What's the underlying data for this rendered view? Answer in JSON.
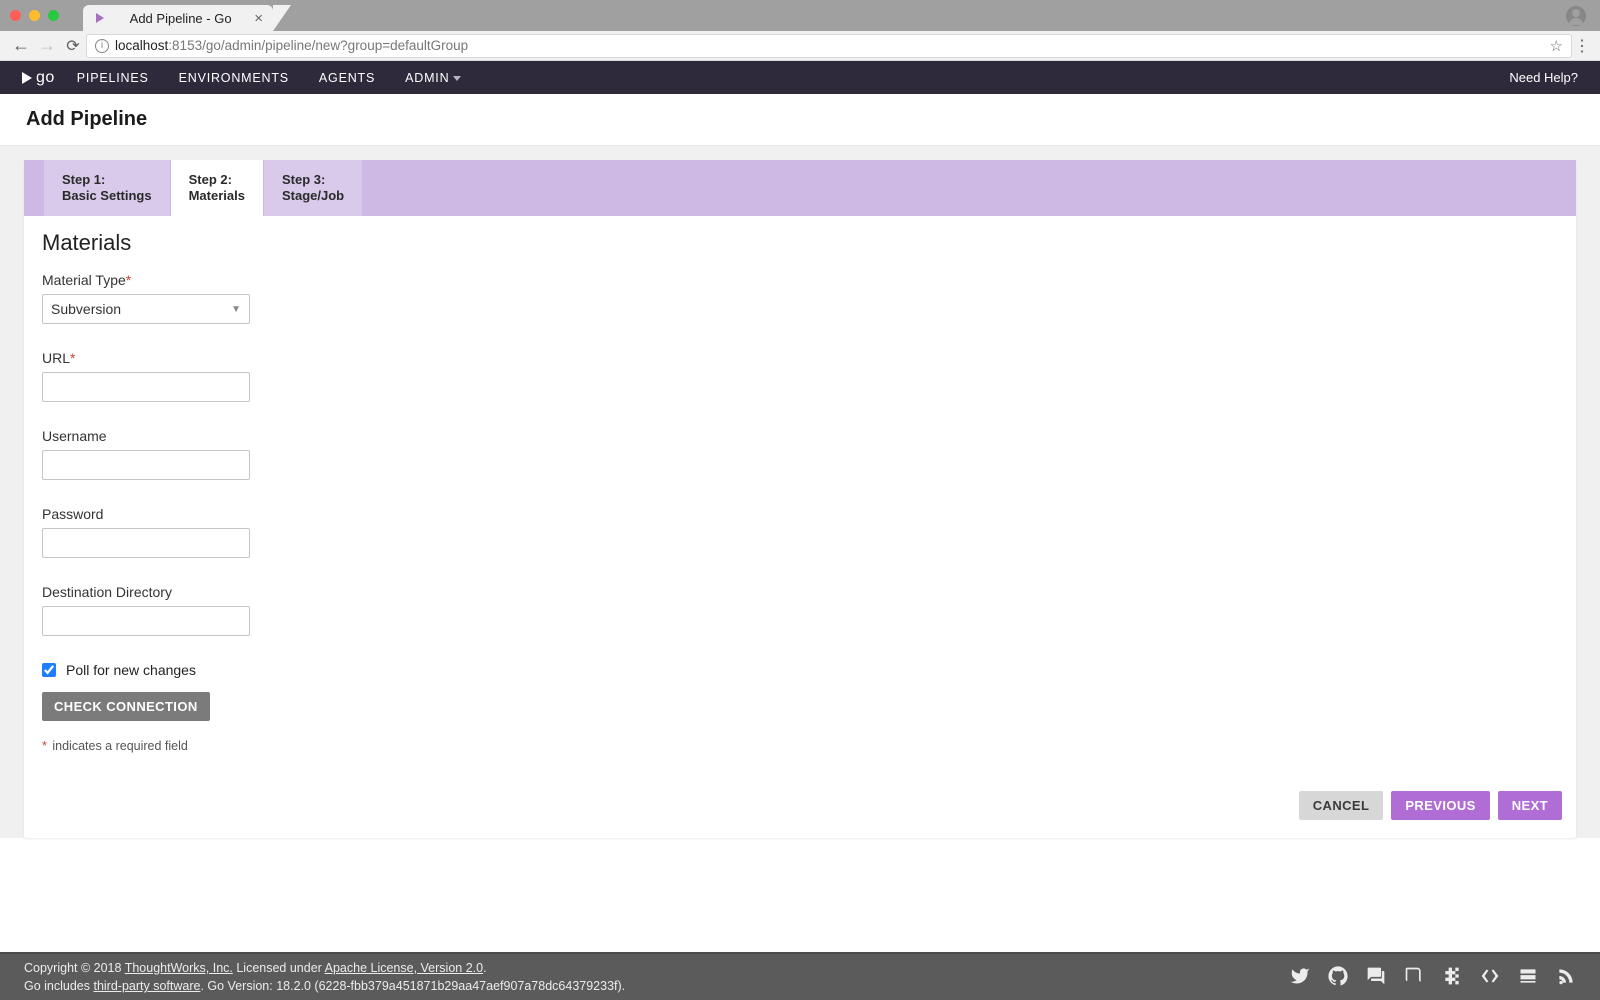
{
  "browser": {
    "tab_title": "Add Pipeline - Go",
    "url_host": "localhost",
    "url_rest": ":8153/go/admin/pipeline/new?group=defaultGroup"
  },
  "nav": {
    "items": [
      "PIPELINES",
      "ENVIRONMENTS",
      "AGENTS",
      "ADMIN"
    ],
    "help": "Need Help?"
  },
  "page": {
    "title": "Add Pipeline"
  },
  "wizard": {
    "tabs": [
      {
        "step": "Step 1:",
        "name": "Basic Settings"
      },
      {
        "step": "Step 2:",
        "name": "Materials"
      },
      {
        "step": "Step 3:",
        "name": "Stage/Job"
      }
    ],
    "active_index": 1,
    "heading": "Materials"
  },
  "form": {
    "material_type": {
      "label": "Material Type",
      "value": "Subversion"
    },
    "url": {
      "label": "URL",
      "value": ""
    },
    "username": {
      "label": "Username",
      "value": ""
    },
    "password": {
      "label": "Password",
      "value": ""
    },
    "dest_dir": {
      "label": "Destination Directory",
      "value": ""
    },
    "poll": {
      "label": "Poll for new changes",
      "checked": true
    },
    "check_button": "CHECK CONNECTION",
    "req_note": "indicates a required field"
  },
  "actions": {
    "cancel": "CANCEL",
    "previous": "PREVIOUS",
    "next": "NEXT"
  },
  "footer": {
    "line1_a": "Copyright © 2018 ",
    "line1_link1": "ThoughtWorks, Inc.",
    "line1_b": " Licensed under ",
    "line1_link2": "Apache License, Version 2.0",
    "line1_c": ".",
    "line2_a": "Go includes ",
    "line2_link": "third-party software",
    "line2_b": ". Go Version: 18.2.0 (6228-fbb379a451871b29aa47aef907a78dc64379233f)."
  }
}
